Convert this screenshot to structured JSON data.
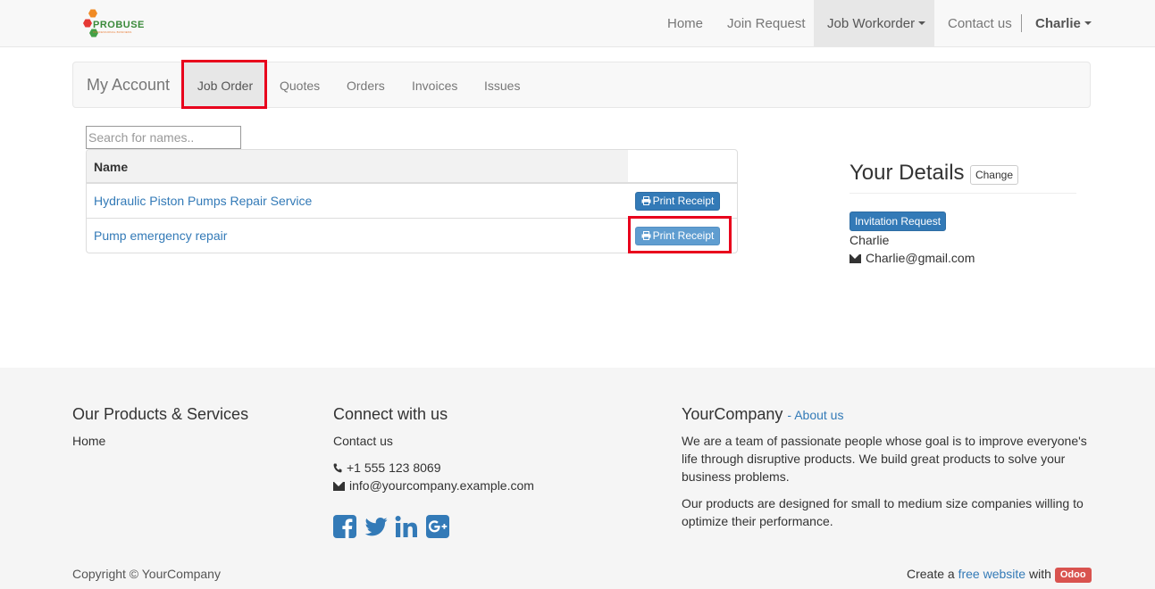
{
  "navbar": {
    "brand_text": "PROBUSE",
    "brand_sub": "PROFESSIONAL BUSINESS",
    "items": [
      {
        "label": "Home"
      },
      {
        "label": "Join Request"
      },
      {
        "label": "Job Workorder"
      },
      {
        "label": "Contact us"
      }
    ],
    "user": "Charlie"
  },
  "account": {
    "title": "My Account",
    "tabs": [
      {
        "label": "Job Order"
      },
      {
        "label": "Quotes"
      },
      {
        "label": "Orders"
      },
      {
        "label": "Invoices"
      },
      {
        "label": "Issues"
      }
    ]
  },
  "search": {
    "placeholder": "Search for names.."
  },
  "table": {
    "header": "Name",
    "rows": [
      {
        "name": "Hydraulic Piston Pumps Repair Service",
        "action": "Print Receipt"
      },
      {
        "name": "Pump emergency repair",
        "action": "Print Receipt"
      }
    ]
  },
  "details": {
    "title": "Your Details",
    "change_label": "Change",
    "badge": "Invitation Request",
    "name": "Charlie",
    "email": "Charlie@gmail.com"
  },
  "footer": {
    "products_title": "Our Products & Services",
    "products_link": "Home",
    "connect_title": "Connect with us",
    "contact_link": "Contact us",
    "phone": "+1 555 123 8069",
    "email": "info@yourcompany.example.com",
    "social": [
      "facebook-icon",
      "twitter-icon",
      "linkedin-icon",
      "google-plus-icon"
    ],
    "company_title": "YourCompany",
    "about_link": "- About us",
    "para1": "We are a team of passionate people whose goal is to improve everyone's life through disruptive products. We build great products to solve your business problems.",
    "para2": "Our products are designed for small to medium size companies willing to optimize their performance.",
    "copyright": "Copyright © YourCompany",
    "create_prefix": "Create a",
    "create_link": "free website",
    "create_with": "with",
    "odoo": "Odoo"
  },
  "colors": {
    "link": "#337ab7",
    "primary_button": "#337ab7",
    "highlight_box": "#e8001c",
    "odoo_badge": "#d9534f",
    "footer_bg": "#f5f5f5"
  }
}
